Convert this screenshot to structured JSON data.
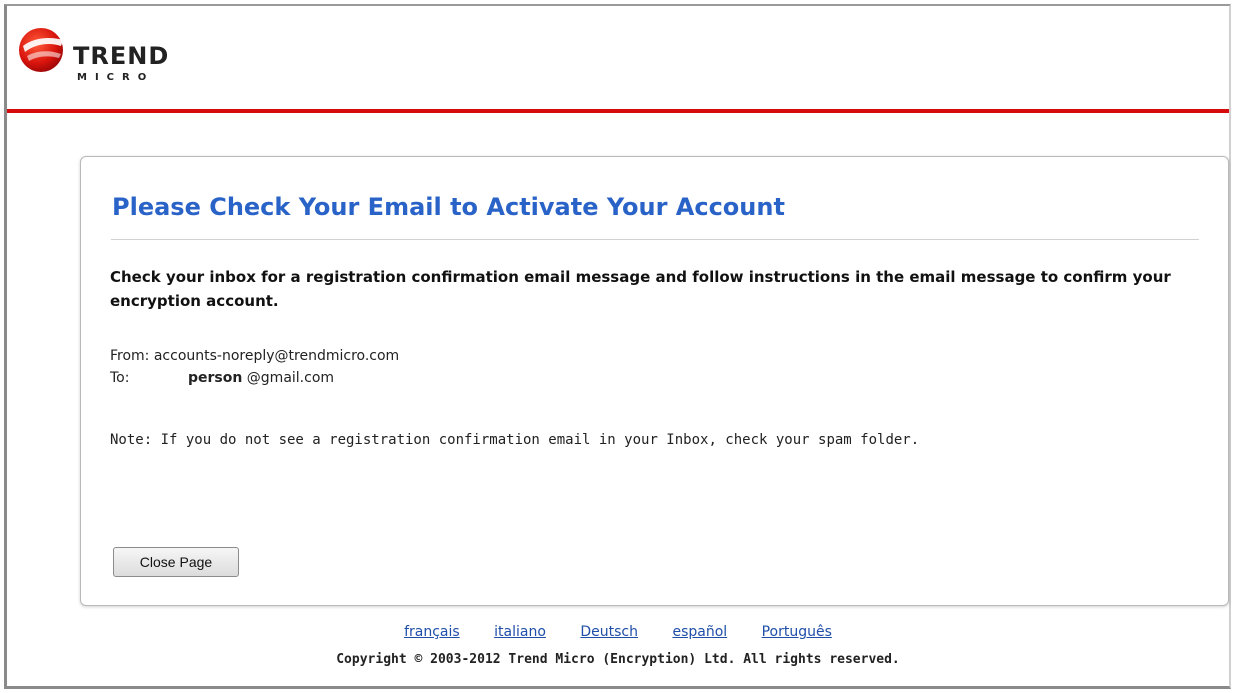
{
  "brand": {
    "logo_word": "TREND",
    "logo_sub": "MICRO",
    "accent_red": "#d60b0b",
    "title_blue": "#2a63c8"
  },
  "panel": {
    "title": "Please Check Your Email to Activate Your Account",
    "instructions": "Check your inbox for a registration confirmation email message and follow instructions in the email message to confirm your encryption account.",
    "from_line": "From: accounts-noreply@trendmicro.com",
    "to_label": "To:",
    "to_user": "person",
    "to_domain": " @gmail.com",
    "note": "Note: If you do not see a registration confirmation email in your Inbox, check your spam folder.",
    "close_button": "Close Page"
  },
  "footer": {
    "languages": [
      "français",
      "italiano",
      "Deutsch",
      "español",
      "Português"
    ],
    "copyright": "Copyright © 2003-2012 Trend Micro (Encryption) Ltd. All rights reserved."
  }
}
